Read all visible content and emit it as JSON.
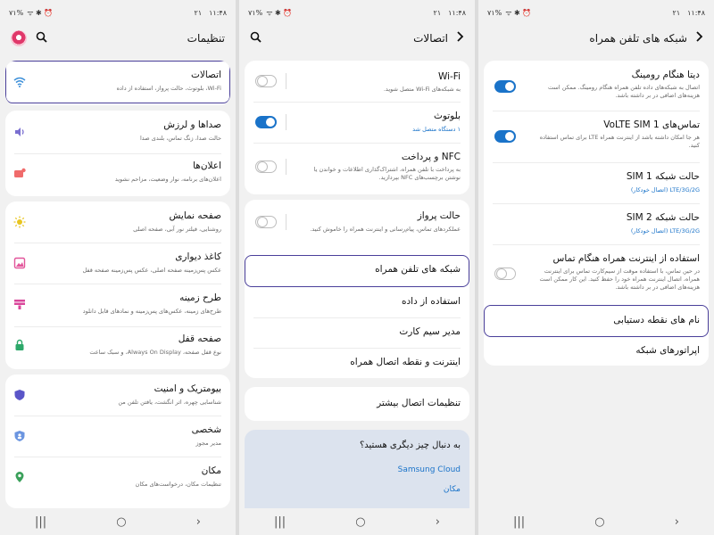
{
  "status": {
    "battery": "۷۱%",
    "time": "۱۱:۴۸",
    "date": "۲۱",
    "icons": "ᯤ ✱ ⏰"
  },
  "nav": {
    "recents": "|||",
    "home": "○",
    "back": "›"
  },
  "screen1": {
    "title": "تنظیمات",
    "items": [
      {
        "title": "اتصالات",
        "sub": "Wi-Fi، بلوتوث، حالت پرواز، استفاده از داده",
        "icon": "wifi-icon"
      },
      {
        "title": "صداها و لرزش",
        "sub": "حالت صدا، زنگ تماس، بلندی صدا",
        "icon": "sound-icon"
      },
      {
        "title": "اعلان‌ها",
        "sub": "اعلان‌های برنامه، نوار وضعیت، مزاحم نشوید",
        "icon": "notification-icon"
      },
      {
        "title": "صفحه نمایش",
        "sub": "روشنایی، فیلتر نور آبی، صفحه اصلی",
        "icon": "brightness-icon"
      },
      {
        "title": "کاغذ دیواری",
        "sub": "عکس پس‌زمینه صفحه اصلی، عکس پس‌زمینه صفحه قفل",
        "icon": "wallpaper-icon"
      },
      {
        "title": "طرح زمینه",
        "sub": "طرح‌های زمینه، عکس‌های پس‌زمینه و نمادهای قابل دانلود",
        "icon": "theme-icon"
      },
      {
        "title": "صفحه قفل",
        "sub": "نوع قفل صفحه، Always On Display، و سبک ساعت",
        "icon": "lock-icon"
      },
      {
        "title": "بیومتریک و امنیت",
        "sub": "شناسایی چهره، اثر انگشت، یافتن تلفن من",
        "icon": "shield-icon"
      },
      {
        "title": "شخصی",
        "sub": "مدیر مجوز",
        "icon": "privacy-icon"
      },
      {
        "title": "مکان",
        "sub": "تنظیمات مکان، درخواست‌های مکان",
        "icon": "location-icon"
      }
    ]
  },
  "screen2": {
    "title": "اتصالات",
    "wifi": {
      "title": "Wi-Fi",
      "sub": "به شبکه‌های Wi-Fi متصل شوید."
    },
    "bluetooth": {
      "title": "بلوتوث",
      "sub": "۱ دستگاه متصل شد"
    },
    "nfc": {
      "title": "NFC و پرداخت",
      "sub": "به پرداخت با تلفن همراه، اشتراک‌گذاری اطلاعات و خواندن یا نوشتن برچسب‌های NFC بپردازید."
    },
    "airplane": {
      "title": "حالت پرواز",
      "sub": "عملکردهای تماس، پیام‌رسانی و اینترنت همراه را خاموش کنید."
    },
    "mobile_networks": "شبکه های تلفن همراه",
    "data_usage": "استفاده از داده",
    "sim_manager": "مدیر سیم کارت",
    "hotspot": "اینترنت و نقطه اتصال همراه",
    "more": "تنظیمات اتصال بیشتر",
    "looking": {
      "question": "به دنبال چیز دیگری هستید؟",
      "link1": "Samsung Cloud",
      "link2": "مکان"
    }
  },
  "screen3": {
    "title": "شبکه های تلفن همراه",
    "roaming": {
      "title": "دیتا هنگام رومینگ",
      "sub": "اتصال به شبکه‌های داده تلفن همراه هنگام رومینگ. ممکن است هزینه‌های اضافی در بر داشته باشد."
    },
    "volte": {
      "title": "تماس‌های VoLTE SIM 1",
      "sub": "هر جا امکان داشته باشد از اینترنت همراه LTE برای تماس استفاده کنید."
    },
    "mode1": {
      "title": "حالت شبکه SIM 1",
      "sub": "LTE/3G/2G (اتصال خودکار)"
    },
    "mode2": {
      "title": "حالت شبکه SIM 2",
      "sub": "LTE/3G/2G (اتصال خودکار)"
    },
    "data_during_calls": {
      "title": "استفاده از اینترنت همراه هنگام تماس",
      "sub": "در حین تماس، با استفاده موقت از سیم‌کارت تماس برای اینترنت همراه، اتصال اینترنت همراه خود را حفظ کنید. این کار ممکن است هزینه‌های اضافی در بر داشته باشد."
    },
    "apn": "نام های نقطه دستیابی",
    "operators": "اپراتورهای شبکه"
  },
  "colors": {
    "accent": "#1a73c9",
    "highlight": "#4a3f9a"
  }
}
